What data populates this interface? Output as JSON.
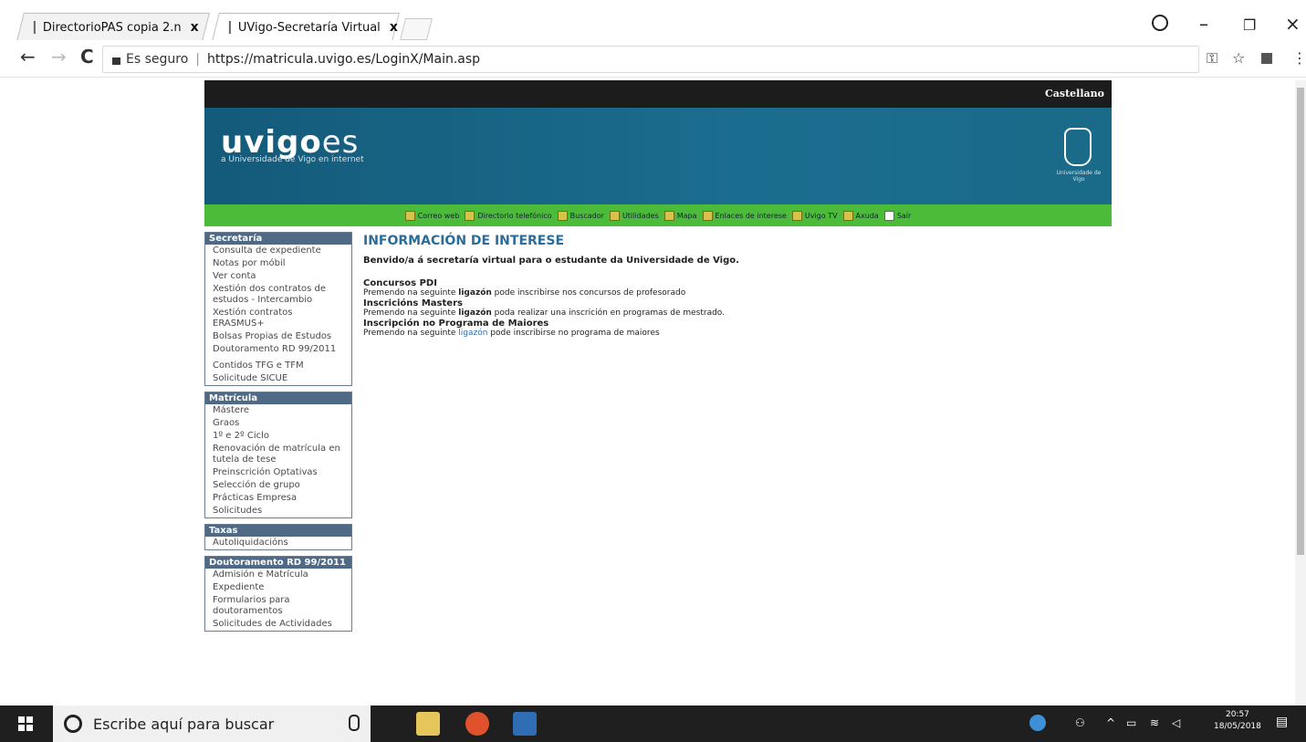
{
  "browser": {
    "tabs": [
      {
        "title": "DirectorioPAS copia 2.n",
        "close": "x"
      },
      {
        "title": "UVigo-Secretaría Virtual",
        "close": "x"
      }
    ],
    "window": {
      "minimize": "–",
      "maximize": "❐",
      "close": "×"
    },
    "nav": {
      "back": "←",
      "forward": "→",
      "reload": "C"
    },
    "security_label": "Es seguro",
    "separator": "|",
    "url": "https://matricula.uvigo.es/LoginX/Main.asp",
    "key_icon": "⚿",
    "star_icon": "☆",
    "menu_icon": "⋮"
  },
  "site": {
    "language_link": "Castellano",
    "brand_bold": "uvigo",
    "brand_light": "es",
    "tagline": "a Universidade de Vigo en internet",
    "crest_caption": "Universidade de Vigo",
    "navbar": [
      "Correo web",
      "Directorio telefónico",
      "Buscador",
      "Utilidades",
      "Mapa",
      "Enlaces de interese",
      "Uvigo TV",
      "Axuda",
      "Saír"
    ]
  },
  "sidebar": {
    "secretaria": {
      "title": "Secretaría",
      "items": [
        "Consulta de expediente",
        "Notas por móbil",
        "Ver conta",
        "Xestión dos contratos de estudos - Intercambio",
        "Xestión contratos ERASMUS+",
        "Bolsas Propias de Estudos",
        "Doutoramento RD 99/2011",
        "Contidos TFG e TFM",
        "Solicitude SICUE"
      ]
    },
    "matricula": {
      "title": "Matrícula",
      "items": [
        "Mástere",
        "Graos",
        "1º e 2º Ciclo",
        "Renovación de matrícula en tutela de tese",
        "Preinscrición Optativas",
        "Selección de grupo",
        "Prácticas Empresa",
        "Solicitudes"
      ]
    },
    "taxas": {
      "title": "Taxas",
      "items": [
        "Autoliquidacións"
      ]
    },
    "doutoramento": {
      "title": "Doutoramento RD 99/2011",
      "items": [
        "Admisión e Matrícula",
        "Expediente",
        "Formularios para doutoramentos",
        "Solicitudes de Actividades"
      ]
    }
  },
  "main": {
    "heading": "INFORMACIÓN DE INTERESE",
    "welcome": "Benvido/a á secretaría virtual para o estudante da Universidade de Vigo.",
    "sections": [
      {
        "title": "Concursos PDI",
        "pre": "Premendo na seguinte ",
        "link": "ligazón",
        "post": " pode inscribirse nos concursos de profesorado"
      },
      {
        "title": "Inscricións Masters",
        "pre": "Premendo na seguinte ",
        "link": "ligazón",
        "post": " poda realizar una inscrición en programas de mestrado."
      },
      {
        "title": "Inscripción no Programa de Maiores",
        "pre": "Premendo na seguinte ",
        "link": "ligazón",
        "post": " pode inscribirse no programa de maiores"
      }
    ]
  },
  "taskbar": {
    "search_placeholder": "Escribe aquí para buscar",
    "time": "20:57",
    "date": "18/05/2018"
  },
  "colors": {
    "banner": "#155e80",
    "navbar": "#4dbb3a",
    "sidebar_header": "#4f6a86",
    "heading": "#2a6d9b",
    "link": "#2d6fb3"
  }
}
